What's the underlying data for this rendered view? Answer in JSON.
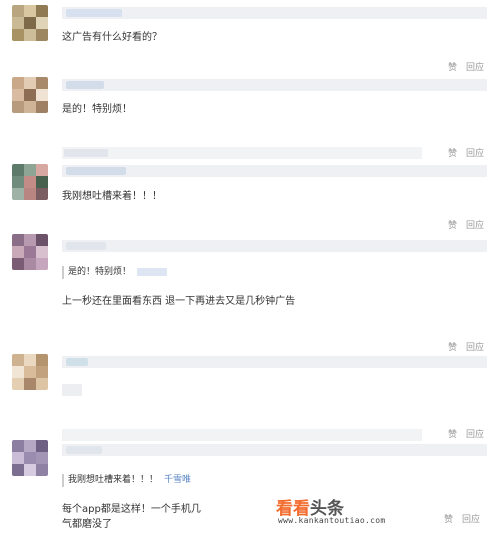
{
  "comments": [
    {
      "text": "这广告有什么好看的？",
      "avatar_colors": [
        "#b9a680",
        "#d8c7a1",
        "#8f7a54",
        "#c9b995",
        "#7e6a48",
        "#e0d4b8",
        "#a89163",
        "#cdbd98",
        "#9c8760"
      ]
    },
    {
      "text": "是的！特别烦！",
      "actions": {
        "like": "赞",
        "reply": "回应"
      },
      "avatar_colors": [
        "#c9a98a",
        "#e2cdb4",
        "#a88a6b",
        "#d8bba0",
        "#8d6e55",
        "#f0e3d3",
        "#b89a7c",
        "#cfb497",
        "#9f8064"
      ]
    },
    {
      "text": "我刚想吐槽来着！！！",
      "actions": {
        "like": "赞",
        "reply": "回应"
      },
      "avatar_colors": [
        "#5e7a6a",
        "#8ea596",
        "#d7a7a2",
        "#6f8c7c",
        "#c38c86",
        "#48614f",
        "#9fb2a6",
        "#b98580",
        "#7a5d60"
      ]
    },
    {
      "text": "上一秒还在里面看东西 退一下再进去又是几秒钟广告",
      "quote": "是的！特别烦！",
      "actions": {
        "like": "赞",
        "reply": "回应"
      },
      "avatar_colors": [
        "#8a6d86",
        "#b89ab0",
        "#6c5269",
        "#c9a8b8",
        "#9b7895",
        "#d8c0cf",
        "#7a5c74",
        "#a98aa2",
        "#c5a6bd"
      ]
    },
    {
      "actions": {
        "like": "赞",
        "reply": "回应"
      },
      "avatar_colors": [
        "#cfb28f",
        "#ead8c1",
        "#b3946f",
        "#f1e5d6",
        "#d9bc9a",
        "#c2a27e",
        "#e5cfb3",
        "#a9876a",
        "#dcc4a5"
      ]
    },
    {
      "text_lines": [
        "每个app都是这样！一个手机几",
        "气都磨没了"
      ],
      "quote": "我刚想吐槽来着！！！",
      "quote_user": "千雪唯",
      "actions": {
        "like": "赞",
        "reply": "回应"
      },
      "avatar_colors": [
        "#8c7ea0",
        "#b5a8c5",
        "#6e6082",
        "#cbbdd8",
        "#9a8caf",
        "#a395b6",
        "#7c6e90",
        "#d6cbe0",
        "#8f81a3"
      ]
    },
    {
      "actions": {
        "like": "赞",
        "reply": "回应"
      }
    }
  ],
  "watermark": {
    "title_part1": "看看",
    "title_part2": "头条",
    "url": "www.kankantoutiao.com",
    "color_part1": "#f26c2e",
    "color_part2": "#555555"
  }
}
